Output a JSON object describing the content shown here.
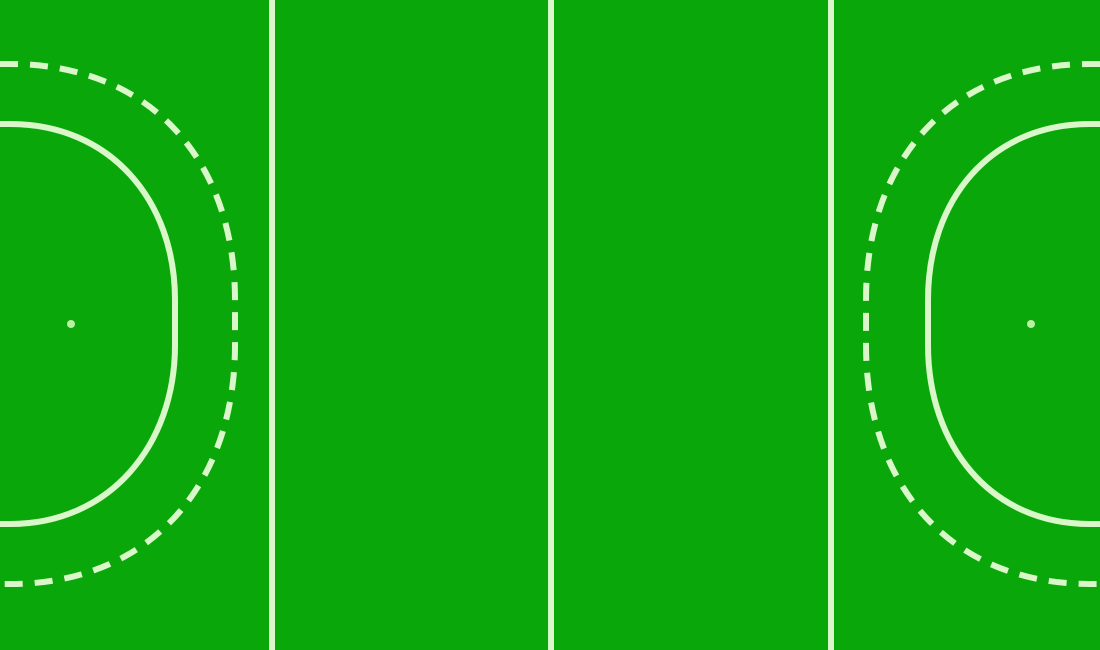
{
  "field": {
    "surface_color": "#0aa70a",
    "line_color": "#d9f7c9",
    "spot_color": "#b9f1a1"
  }
}
